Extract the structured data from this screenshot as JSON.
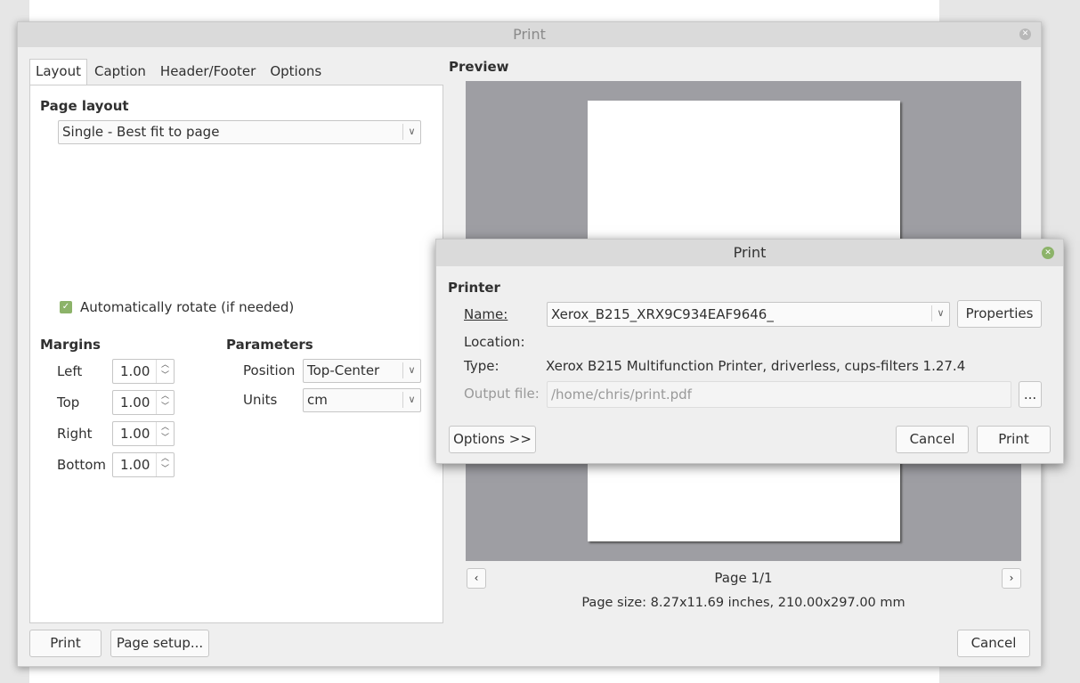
{
  "main_dialog": {
    "title": "Print",
    "tabs": [
      "Layout",
      "Caption",
      "Header/Footer",
      "Options"
    ],
    "page_layout": {
      "heading": "Page layout",
      "value": "Single - Best fit to page"
    },
    "auto_rotate": {
      "label": "Automatically rotate (if needed)",
      "checked": true
    },
    "margins": {
      "heading": "Margins",
      "fields": [
        {
          "label": "Left",
          "value": "1.00"
        },
        {
          "label": "Top",
          "value": "1.00"
        },
        {
          "label": "Right",
          "value": "1.00"
        },
        {
          "label": "Bottom",
          "value": "1.00"
        }
      ]
    },
    "parameters": {
      "heading": "Parameters",
      "position_label": "Position",
      "position_value": "Top-Center",
      "units_label": "Units",
      "units_value": "cm"
    },
    "preview": {
      "heading": "Preview",
      "page_indicator": "Page 1/1",
      "page_size": "Page size: 8.27x11.69 inches, 210.00x297.00 mm"
    },
    "buttons": {
      "print": "Print",
      "page_setup": "Page setup...",
      "cancel": "Cancel"
    }
  },
  "printer_dialog": {
    "title": "Print",
    "heading": "Printer",
    "name_label": "Name:",
    "name_value": "Xerox_B215_XRX9C934EAF9646_",
    "properties": "Properties",
    "location_label": "Location:",
    "location_value": "",
    "type_label": "Type:",
    "type_value": "Xerox B215 Multifunction Printer, driverless, cups-filters 1.27.4",
    "output_label": "Output file:",
    "output_value": "/home/chris/print.pdf",
    "browse": "...",
    "options": "Options >>",
    "cancel": "Cancel",
    "print": "Print"
  },
  "colors": {
    "accent": "#8cb369",
    "preview_bg": "#9e9ea3"
  }
}
